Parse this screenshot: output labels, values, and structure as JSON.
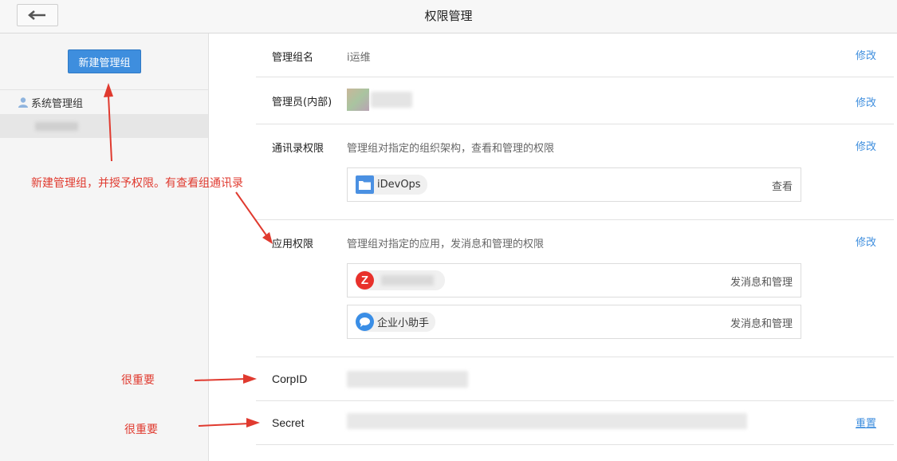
{
  "header": {
    "title": "权限管理"
  },
  "sidebar": {
    "new_group_button": "新建管理组",
    "group_label": "系统管理组"
  },
  "annotations": {
    "main_note": "新建管理组，并授予权限。有查看组通讯录",
    "important_1": "很重要",
    "important_2": "很重要"
  },
  "content": {
    "group_name": {
      "label": "管理组名",
      "value": "i运维",
      "action": "修改"
    },
    "admins": {
      "label": "管理员(内部)",
      "action": "修改"
    },
    "contacts": {
      "label": "通讯录权限",
      "desc": "管理组对指定的组织架构，查看和管理的权限",
      "action": "修改",
      "items": [
        {
          "name": "iDevOps",
          "permission": "查看"
        }
      ]
    },
    "apps": {
      "label": "应用权限",
      "desc": "管理组对指定的应用，发消息和管理的权限",
      "action": "修改",
      "items": [
        {
          "name": "",
          "permission": "发消息和管理"
        },
        {
          "name": "企业小助手",
          "permission": "发消息和管理"
        }
      ]
    },
    "corpid": {
      "label": "CorpID"
    },
    "secret": {
      "label": "Secret",
      "action": "重置"
    }
  },
  "colors": {
    "accent": "#3e8ede",
    "annotation": "#e03a2f",
    "app_red": "#e8312b"
  }
}
